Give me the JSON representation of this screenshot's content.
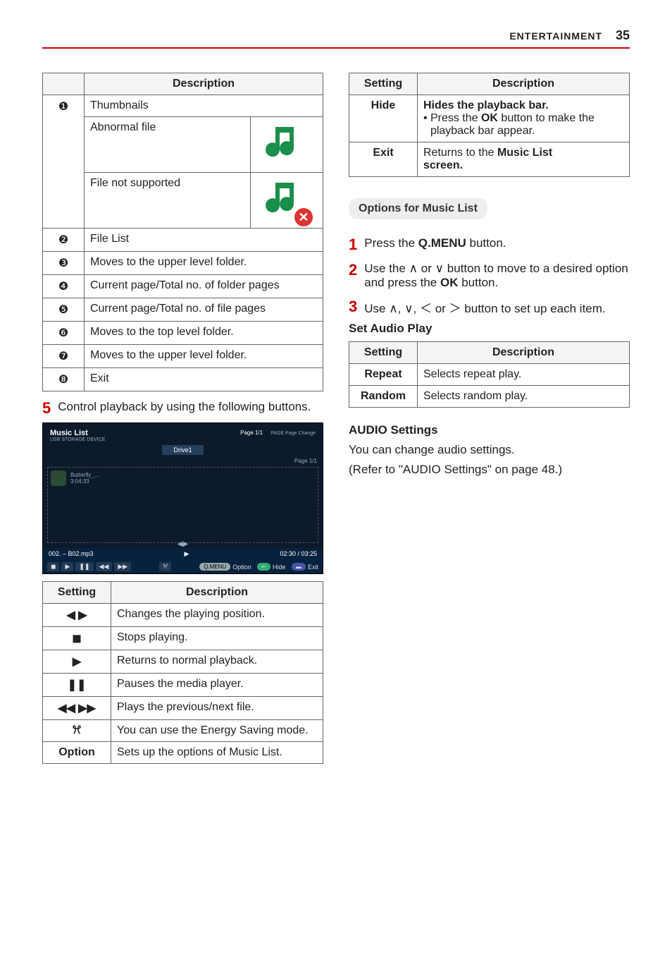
{
  "header": {
    "section": "ENTERTAINMENT",
    "page_number": "35"
  },
  "left": {
    "desc_table": {
      "header": "Description",
      "rows": [
        {
          "num": "❶",
          "lines": [
            "Thumbnails",
            "Abnormal file",
            "File not supported"
          ]
        },
        {
          "num": "❷",
          "text": "File List"
        },
        {
          "num": "❸",
          "text": "Moves to the upper level folder."
        },
        {
          "num": "❹",
          "text": "Current page/Total no. of folder pages"
        },
        {
          "num": "❺",
          "text": "Current page/Total no. of file pages"
        },
        {
          "num": "❻",
          "text": "Moves to the top level folder."
        },
        {
          "num": "❼",
          "text": "Moves to the upper level folder."
        },
        {
          "num": "❽",
          "text": "Exit"
        }
      ]
    },
    "step5": {
      "num": "5",
      "text": "Control playback by using the following buttons."
    },
    "media": {
      "title": "Music List",
      "subtitle": "USB STORAGE DEVICE",
      "top_right_page": "Page 1/1",
      "top_right_hint": "PAGE Page Change",
      "drive_label": "Drive1",
      "list_page": "Page 1/1",
      "item_name": "Butterfly_...",
      "item_len": "3:04:33",
      "now_title": "002. – B02.mp3",
      "now_time": "02:30 / 03:25",
      "btn_stop": "◼",
      "btn_play": "▶",
      "btn_pause": "❚❚",
      "btn_prev": "◀◀",
      "btn_next": "▶▶",
      "btn_energy": "ꕮ",
      "lbl_option": "Option",
      "lbl_hide": "Hide",
      "lbl_exit": "Exit",
      "lbl_qmenu": "Q.MENU"
    },
    "controls_table": {
      "headers": [
        "Setting",
        "Description"
      ],
      "rows": [
        {
          "setting": "◀ ▶",
          "desc": "Changes the playing position."
        },
        {
          "setting": "◼",
          "desc": "Stops playing."
        },
        {
          "setting": "▶",
          "desc": "Returns to normal playback."
        },
        {
          "setting": "❚❚",
          "desc": "Pauses the media player."
        },
        {
          "setting": "◀◀ ▶▶",
          "desc": "Plays the previous/next file."
        },
        {
          "setting": "ꕮ",
          "desc": "You can use the Energy Saving mode."
        },
        {
          "setting": "Option",
          "desc": "Sets up the options of Music List."
        }
      ]
    }
  },
  "right": {
    "top_table": {
      "headers": [
        "Setting",
        "Description"
      ],
      "rows": [
        {
          "setting": "Hide",
          "lead_bold": "Hides the playback bar.",
          "bullet_pre": "Press the ",
          "bullet_bold": "OK",
          "bullet_post": " button to make the playback bar appear."
        },
        {
          "setting": "Exit",
          "pre": "Returns to the ",
          "bold1": "Music List",
          "bold2": "screen."
        }
      ]
    },
    "section_header": "Options for Music List",
    "step1": {
      "num": "1",
      "pre": "Press the ",
      "bold": "Q.MENU",
      "post": " button."
    },
    "step2": {
      "num": "2",
      "pre": "Use the ",
      "sym1": "∧",
      "mid1": " or ",
      "sym2": "∨",
      "mid2": " button to move to a desired option and press the ",
      "bold": "OK",
      "post": " button."
    },
    "step3": {
      "num": "3",
      "pre": "Use ",
      "syms": "∧, ∨, ＜ or ＞",
      "post": " button to set up each item."
    },
    "audio_play_header": "Set Audio Play",
    "audio_play_table": {
      "headers": [
        "Setting",
        "Description"
      ],
      "rows": [
        {
          "setting": "Repeat",
          "desc": "Selects repeat play."
        },
        {
          "setting": "Random",
          "desc": "Selects random play."
        }
      ]
    },
    "audio_settings": {
      "title": "AUDIO Settings",
      "line1": "You can change audio settings.",
      "line2": "(Refer to \"AUDIO Settings\" on page 48.)"
    }
  }
}
